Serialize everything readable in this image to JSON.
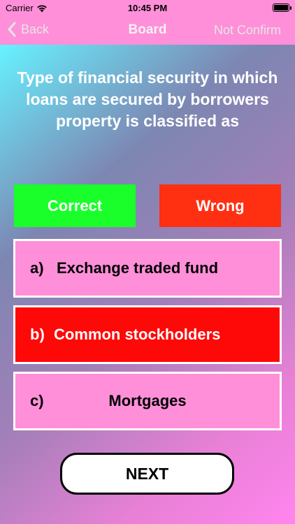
{
  "status_bar": {
    "carrier": "Carrier",
    "time": "10:45 PM"
  },
  "nav": {
    "back_label": "Back",
    "title": "Board",
    "right_label": "Not Confirm"
  },
  "question": {
    "text": "Type of financial security in which loans are secured by borrowers property is classified as"
  },
  "indicators": {
    "correct_label": "Correct",
    "wrong_label": "Wrong"
  },
  "options": [
    {
      "letter": "a)",
      "text": "Exchange traded fund",
      "state": "default"
    },
    {
      "letter": "b)",
      "text": "Common stockholders",
      "state": "selected-wrong"
    },
    {
      "letter": "c)",
      "text": "Mortgages",
      "state": "default"
    }
  ],
  "next_button": {
    "label": "NEXT"
  },
  "colors": {
    "header_bg": "#ff8fd9",
    "correct": "#1aff2a",
    "wrong": "#ff2f12",
    "option_bg": "#ff8fd9",
    "option_selected_wrong": "#ff0808"
  }
}
